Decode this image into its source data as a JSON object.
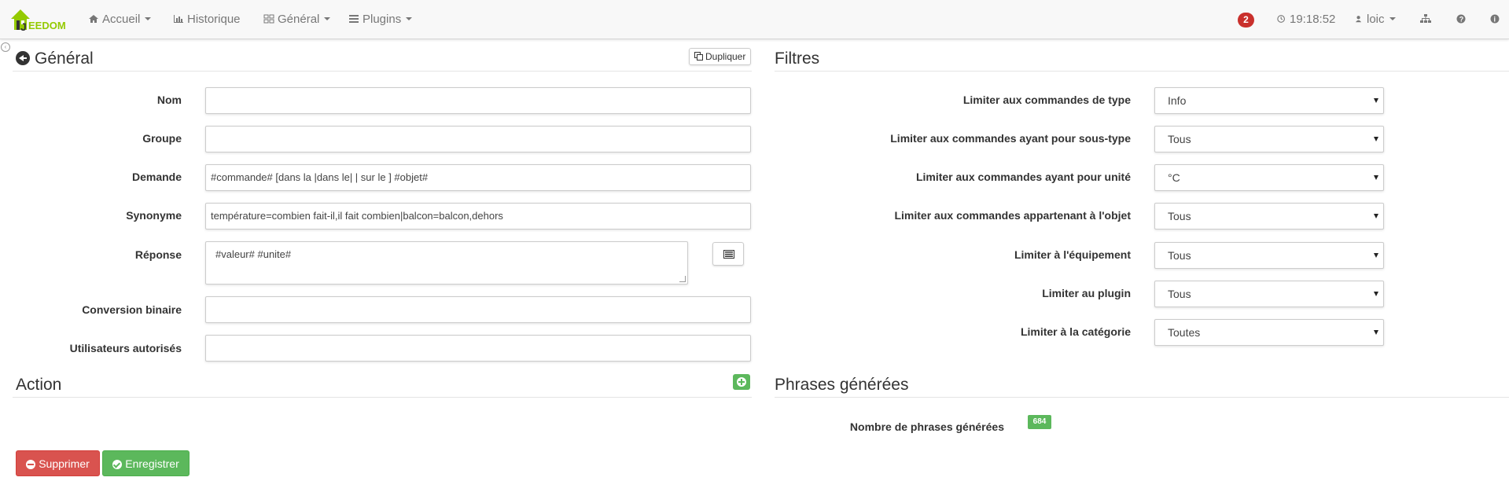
{
  "navbar": {
    "logo_text": "EEDOM",
    "accueil": "Accueil",
    "historique": "Historique",
    "general": "Général",
    "plugins": "Plugins",
    "message_count": "2",
    "time": "19:18:52",
    "user": "loic"
  },
  "general_section": {
    "title": "Général",
    "duplicate_label": "Dupliquer",
    "fields": {
      "nom": {
        "label": "Nom",
        "value": ""
      },
      "groupe": {
        "label": "Groupe",
        "value": ""
      },
      "demande": {
        "label": "Demande",
        "value": "#commande# [dans la |dans le| | sur le ] #objet#"
      },
      "synonyme": {
        "label": "Synonyme",
        "value": "température=combien fait-il,il fait combien|balcon=balcon,dehors"
      },
      "reponse": {
        "label": "Réponse",
        "value": "#valeur# #unite#"
      },
      "conversion": {
        "label": "Conversion binaire",
        "value": ""
      },
      "utilisateurs": {
        "label": "Utilisateurs autorisés",
        "value": ""
      }
    }
  },
  "filters_section": {
    "title": "Filtres",
    "filters": [
      {
        "label": "Limiter aux commandes de type",
        "value": "Info"
      },
      {
        "label": "Limiter aux commandes ayant pour sous-type",
        "value": "Tous"
      },
      {
        "label": "Limiter aux commandes ayant pour unité",
        "value": "°C"
      },
      {
        "label": "Limiter aux commandes appartenant à l'objet",
        "value": "Tous"
      },
      {
        "label": "Limiter à l'équipement",
        "value": "Tous"
      },
      {
        "label": "Limiter au plugin",
        "value": "Tous"
      },
      {
        "label": "Limiter à la catégorie",
        "value": "Toutes"
      }
    ]
  },
  "action_section": {
    "title": "Action"
  },
  "phrases_section": {
    "title": "Phrases générées",
    "count_label": "Nombre de phrases générées",
    "count": "684"
  },
  "buttons": {
    "delete": "Supprimer",
    "save": "Enregistrer"
  },
  "colors": {
    "danger": "#d9534f",
    "success": "#5cb85c",
    "badge_red": "#c9302c"
  }
}
